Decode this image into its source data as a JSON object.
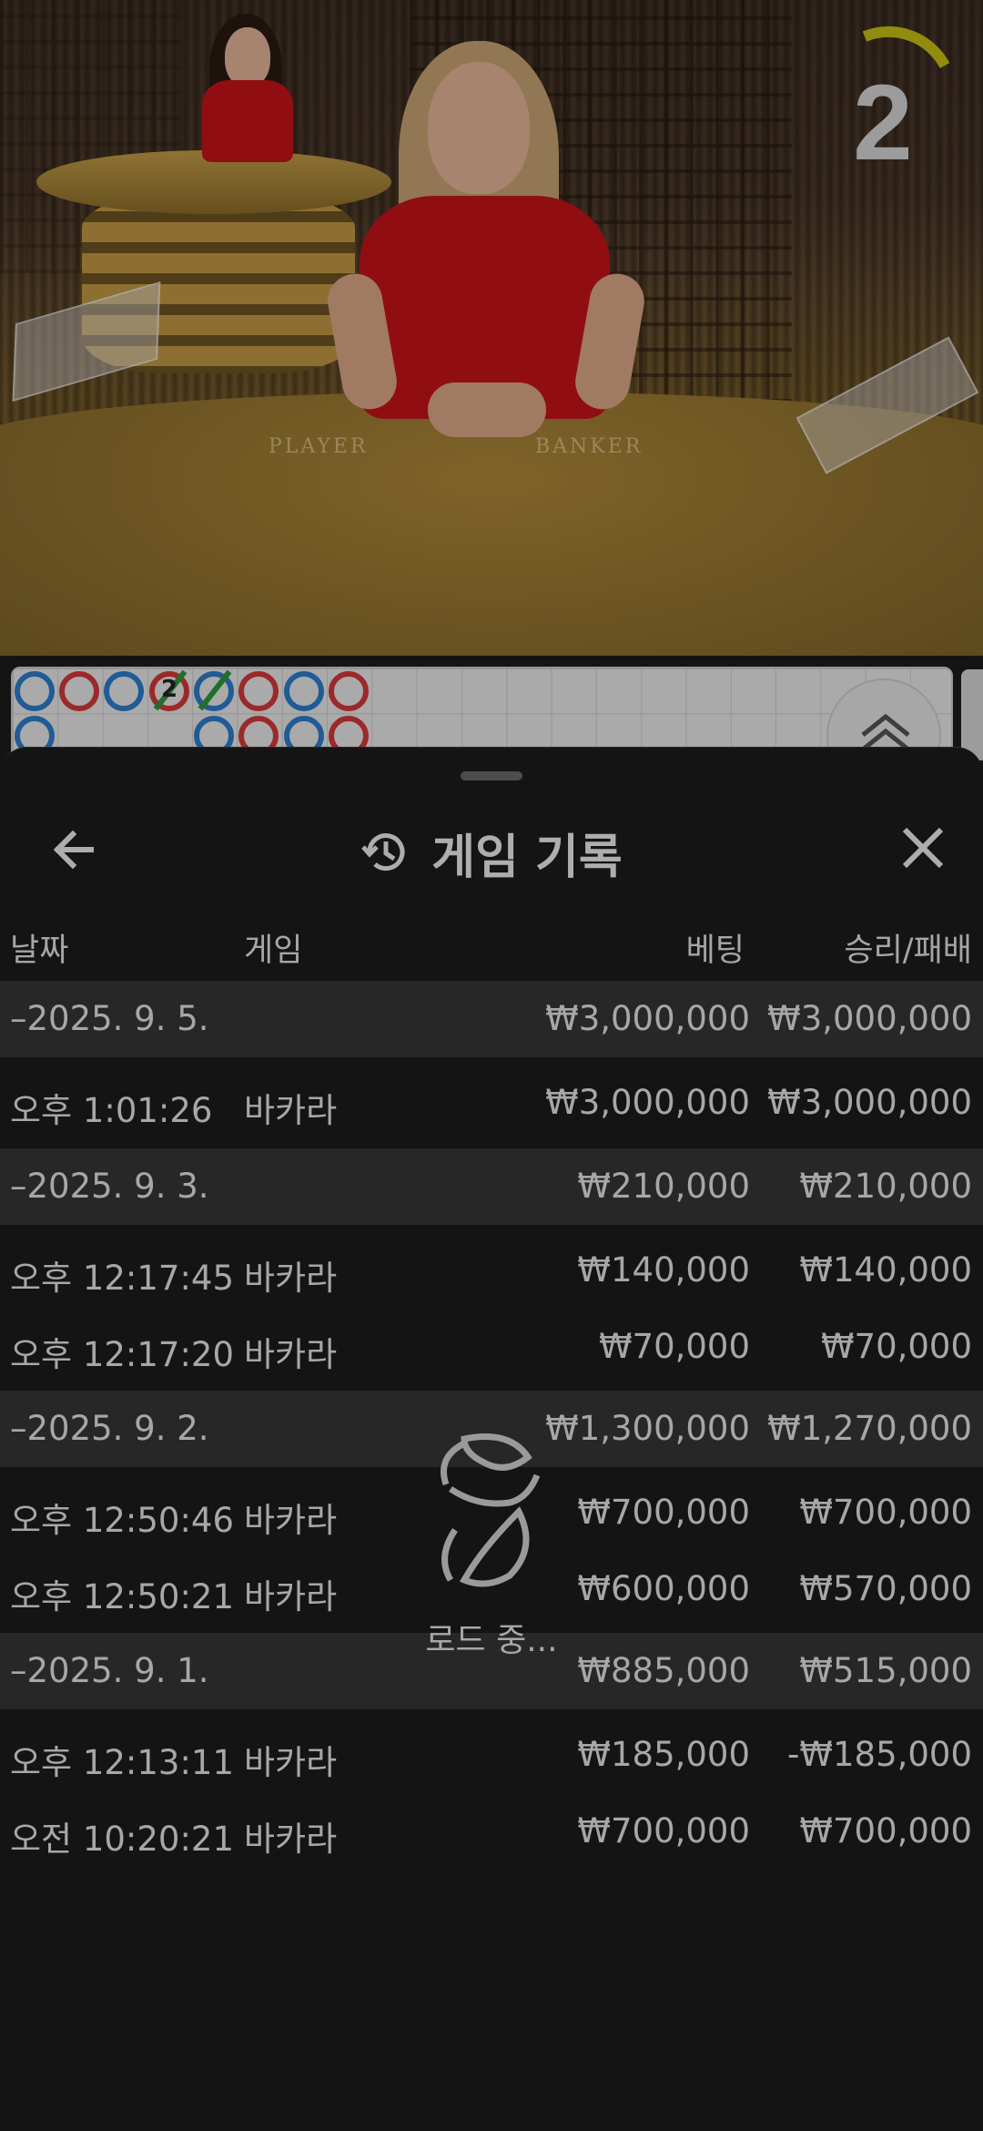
{
  "video": {
    "countdown": "2",
    "table_labels": {
      "player": "PLAYER",
      "banker": "BANKER"
    }
  },
  "roadmap": {
    "beads_row1": [
      "b",
      "r",
      "b",
      "r",
      "b",
      "r",
      "b",
      "r"
    ],
    "beads_row2": [
      "b",
      "",
      "",
      "",
      "b",
      "r",
      "b",
      "r"
    ],
    "marker_number": "2"
  },
  "sheet": {
    "title": "게임 기록",
    "back_icon": "arrow-left-icon",
    "close_icon": "close-icon",
    "history_icon": "history-icon",
    "columns": {
      "date": "날짜",
      "game": "게임",
      "bet": "베팅",
      "win_loss": "승리/패배"
    },
    "groups": [
      {
        "date": "–2025. 9. 5.",
        "bet": "₩3,000,000",
        "win_loss": "₩3,000,000",
        "entries": [
          {
            "time": "오후 1:01:26",
            "game": "바카라",
            "bet": "₩3,000,000",
            "win_loss": "₩3,000,000"
          }
        ]
      },
      {
        "date": "–2025. 9. 3.",
        "bet": "₩210,000",
        "win_loss": "₩210,000",
        "entries": [
          {
            "time": "오후 12:17:45",
            "game": "바카라",
            "bet": "₩140,000",
            "win_loss": "₩140,000"
          },
          {
            "time": "오후 12:17:20",
            "game": "바카라",
            "bet": "₩70,000",
            "win_loss": "₩70,000"
          }
        ]
      },
      {
        "date": "–2025. 9. 2.",
        "bet": "₩1,300,000",
        "win_loss": "₩1,270,000",
        "entries": [
          {
            "time": "오후 12:50:46",
            "game": "바카라",
            "bet": "₩700,000",
            "win_loss": "₩700,000"
          },
          {
            "time": "오후 12:50:21",
            "game": "바카라",
            "bet": "₩600,000",
            "win_loss": "₩570,000"
          }
        ]
      },
      {
        "date": "–2025. 9. 1.",
        "bet": "₩885,000",
        "win_loss": "₩515,000",
        "entries": [
          {
            "time": "오후 12:13:11",
            "game": "바카라",
            "bet": "₩185,000",
            "win_loss": "-₩185,000"
          },
          {
            "time": "오전 10:20:21",
            "game": "바카라",
            "bet": "₩700,000",
            "win_loss": "₩700,000"
          }
        ]
      }
    ],
    "loading_label": "로드 중..."
  },
  "colors": {
    "sheet_bg": "#1c1c1c",
    "date_row_bg": "#373737",
    "player_blue": "#2f7fd0",
    "banker_red": "#d8393a",
    "tie_green": "#2e9a3c"
  }
}
